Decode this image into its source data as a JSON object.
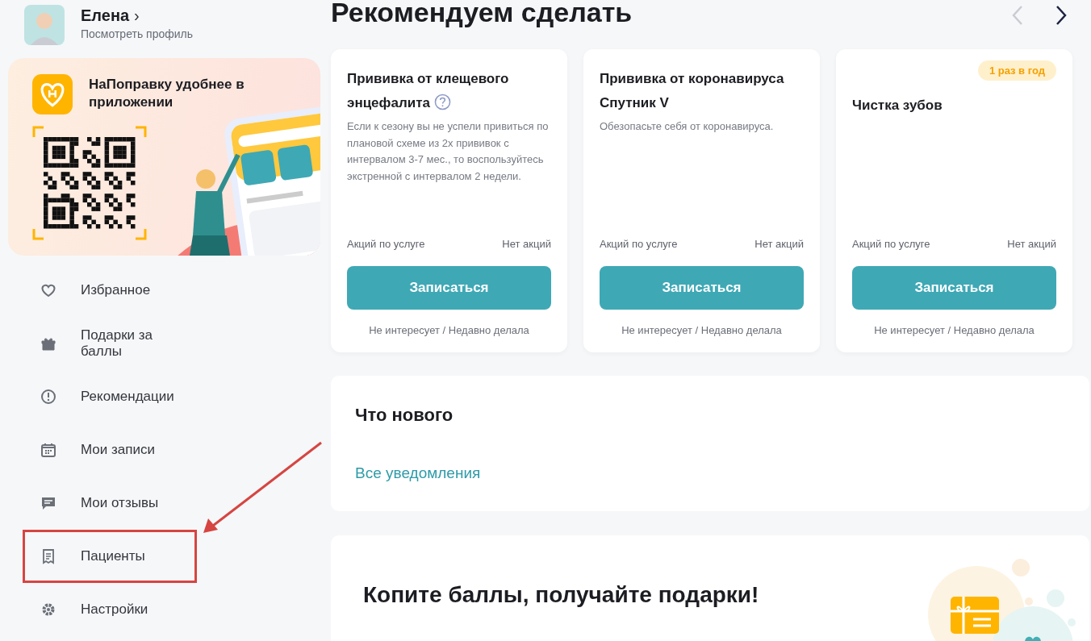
{
  "profile": {
    "name": "Елена",
    "chevron": "›",
    "link": "Посмотреть профиль"
  },
  "promo": {
    "title": "НаПоправку удобнее в приложении"
  },
  "nav": [
    {
      "label": "Избранное",
      "highlighted": false
    },
    {
      "label": "Подарки за баллы",
      "highlighted": false
    },
    {
      "label": "Рекомендации",
      "highlighted": false
    },
    {
      "label": "Мои записи",
      "highlighted": false
    },
    {
      "label": "Мои отзывы",
      "highlighted": false
    },
    {
      "label": "Пациенты",
      "highlighted": true
    },
    {
      "label": "Настройки",
      "highlighted": false
    }
  ],
  "recommendations": {
    "title": "Рекомендуем сделать",
    "prev_disabled": true,
    "next_disabled": false,
    "cards": [
      {
        "title": "Прививка от клещевого энцефалита",
        "has_help": true,
        "description": "Если к сезону вы не успели привиться по плановой схеме из 2х прививок с интервалом 3-7 мес., то воспользуйтесь экстренной с интервалом 2 недели.",
        "promo_label": "Акций по услуге",
        "promo_value": "Нет акций",
        "button": "Записаться",
        "dismiss": "Не интересует / Недавно делала"
      },
      {
        "title": "Прививка от коронавируса Спутник V",
        "has_help": false,
        "description": "Обезопасьте себя от коронавируса.",
        "promo_label": "Акций по услуге",
        "promo_value": "Нет акций",
        "button": "Записаться",
        "dismiss": "Не интересует / Недавно делала"
      },
      {
        "title": "Чистка зубов",
        "has_help": false,
        "badge": "1 раз в год",
        "promo_label": "Акций по услуге",
        "promo_value": "Нет акций",
        "button": "Записаться",
        "dismiss": "Не интересует / Недавно делала"
      }
    ]
  },
  "news": {
    "title": "Что нового",
    "link": "Все уведомления"
  },
  "bonus": {
    "title": "Копите баллы, получайте подарки!"
  }
}
